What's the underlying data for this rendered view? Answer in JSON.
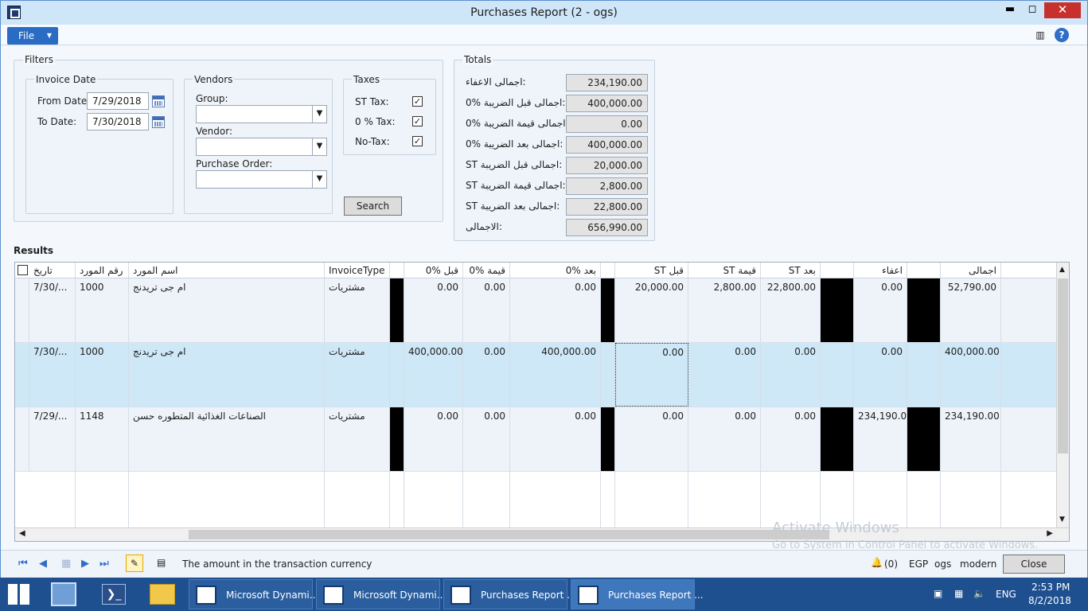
{
  "window": {
    "title": "Purchases Report (2 - ogs)",
    "minimize": "▬",
    "maximize": "◻",
    "close": "✕"
  },
  "menu": {
    "file": "File"
  },
  "filters": {
    "title": "Filters",
    "invoice_date": {
      "title": "Invoice Date",
      "from_label": "From Date:",
      "from_value": "7/29/2018",
      "to_label": "To Date:",
      "to_value": "7/30/2018"
    },
    "vendors": {
      "title": "Vendors",
      "group_label": "Group:",
      "vendor_label": "Vendor:",
      "po_label": "Purchase Order:"
    },
    "taxes": {
      "title": "Taxes",
      "st_label": "ST Tax:",
      "zero_label": "0 % Tax:",
      "notax_label": "No-Tax:",
      "st_checked": true,
      "zero_checked": true,
      "notax_checked": true
    },
    "search": "Search"
  },
  "totals": {
    "title": "Totals",
    "rows": [
      {
        "label": "اجمالى الاعفاء:",
        "value": "234,190.00"
      },
      {
        "label": "0% اجمالى قبل الضريبة:",
        "value": "400,000.00"
      },
      {
        "label": "0% اجمالى قيمة الضريبة:",
        "value": "0.00"
      },
      {
        "label": "0% اجمالى بعد الضريبة:",
        "value": "400,000.00"
      },
      {
        "label": "ST اجمالى قبل الضريبة:",
        "value": "20,000.00"
      },
      {
        "label": "ST اجمالى قيمة الضريبة:",
        "value": "2,800.00"
      },
      {
        "label": "ST اجمالى بعد الضريبة:",
        "value": "22,800.00"
      },
      {
        "label": "الاجمالى:",
        "value": "656,990.00"
      }
    ]
  },
  "results": {
    "title": "Results",
    "headers": [
      "تاريخ",
      "رقم المورد",
      "اسم المورد",
      "InvoiceType",
      "",
      "0% قبل",
      "0% قيمة",
      "0% بعد",
      "",
      "ST قبل",
      "ST قيمة",
      "ST بعد",
      "",
      "اعفاء",
      "",
      "اجمالى"
    ],
    "rows": [
      [
        "7/30/...",
        "1000",
        "ام جى تريدنج",
        "مشتريات",
        "",
        "0.00",
        "0.00",
        "0.00",
        "",
        "20,000.00",
        "2,800.00",
        "22,800.00",
        "",
        "0.00",
        "",
        "52,790.00"
      ],
      [
        "7/30/...",
        "1000",
        "ام جى تريدنج",
        "مشتريات",
        "",
        "400,000.00",
        "0.00",
        "400,000.00",
        "",
        "0.00",
        "0.00",
        "0.00",
        "",
        "0.00",
        "",
        "400,000.00"
      ],
      [
        "7/29/...",
        "1148",
        "الصناعات الغذائية المتطوره حسن",
        "مشتريات",
        "",
        "0.00",
        "0.00",
        "0.00",
        "",
        "0.00",
        "0.00",
        "0.00",
        "",
        "234,190.00",
        "",
        "234,190.00"
      ]
    ]
  },
  "status": {
    "message": "The amount in the transaction currency",
    "alerts": "(0)",
    "currency": "EGP",
    "company": "ogs",
    "layer": "modern",
    "close": "Close"
  },
  "watermark": {
    "line1": "Activate Windows",
    "line2": "Go to System in Control Panel to activate Windows."
  },
  "taskbar": {
    "items": [
      "Microsoft Dynami...",
      "Microsoft Dynami...",
      "Purchases Report ...",
      "Purchases Report ..."
    ],
    "lang": "ENG",
    "time": "2:53 PM",
    "date": "8/2/2018"
  }
}
